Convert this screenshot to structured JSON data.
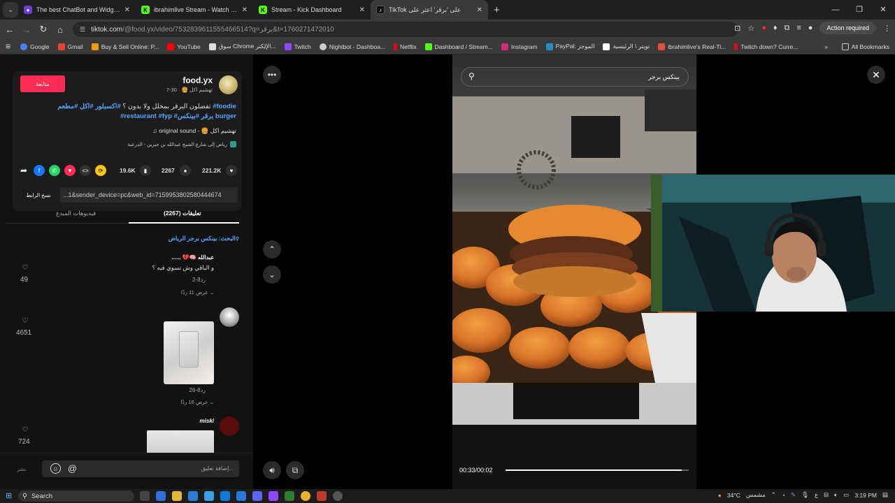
{
  "browser": {
    "tabs": [
      {
        "title": "The best ChatBot and Widgets",
        "icon": "chatbot-favicon-icon",
        "color": "#6b3fd4",
        "active": false
      },
      {
        "title": "ibrahimlive Stream - Watch Live",
        "icon": "kick-favicon-icon",
        "color": "#53fc18",
        "active": false
      },
      {
        "title": "Stream - Kick Dashboard",
        "icon": "kick-favicon-icon",
        "color": "#53fc18",
        "active": false
      },
      {
        "title": "TikTok على 'برقر' اعثر على",
        "icon": "tiktok-favicon-icon",
        "color": "#000000",
        "active": true
      }
    ],
    "url_host": "tiktok.com",
    "url_path": "/@food.yx/video/7532839611555466514?q=برقر&t=1760271472010",
    "action_required": "Action required",
    "bookmarks": [
      {
        "label": "Google",
        "color": "#4285f4"
      },
      {
        "label": "Gmail",
        "color": "#ea4335"
      },
      {
        "label": "Buy & Sell Online: P...",
        "color": "#f39c12"
      },
      {
        "label": "YouTube",
        "color": "#ff0000"
      },
      {
        "label": "سوق Chrome الإلكتر...",
        "color": "#dddddd"
      },
      {
        "label": "Twitch",
        "color": "#9146ff"
      },
      {
        "label": "Nightbot - Dashboa...",
        "color": "#cccccc"
      },
      {
        "label": "Netflix",
        "color": "#e50914"
      },
      {
        "label": "Dashboard / Stream...",
        "color": "#53fc18"
      },
      {
        "label": "Instagram",
        "color": "#d62976"
      },
      {
        "label": "PayPal: الموجز",
        "color": "#2790c3"
      },
      {
        "label": "تويتر \\ الرئيسية",
        "color": "#ffffff"
      },
      {
        "label": "ibrahimlive's Real-Ti...",
        "color": "#e74c3c"
      },
      {
        "label": "Twitch down? Curre...",
        "color": "#e50914"
      }
    ],
    "all_bookmarks": "All Bookmarks"
  },
  "post": {
    "follow_label": "متابعة",
    "username": "food.yx",
    "meta": "7-30 · 🍔 تهشيم اكل",
    "caption_text": "تفضلون البرقر بمخلل ولا بدون ؟",
    "caption_tags": "#اكسبلور #اكل #مطعم #foodie #restaurant #fyp #برقر #بينكس burger",
    "sound": "♫ original sound - 🍔 تهشيم اكل",
    "location": "رياض إلى شارع الشيخ عبدالله بن جبرين - الدرعية",
    "likes": "221.2K",
    "comments": "2267",
    "saves": "19.6K",
    "copy_link": "نسخ الرابط",
    "link_value": "...1&sender_device=pc&web_id=7159953802580444674",
    "tab_comments": "(2267) تعليقات",
    "tab_creator_videos": "فيديوهات المبدع",
    "search_suggest": "البحث: بينكس برجر الرياض",
    "add_comment_placeholder": "إضافة تعليق...",
    "send_label": "نشر"
  },
  "comments": [
    {
      "name": "...... 💔🧠 عبدالله",
      "text": "و الباقي وش تسوي فيه ؟",
      "date": "8-2",
      "reply": "رد",
      "more": "عرض 11 ردًا",
      "likes": "49"
    },
    {
      "name": "",
      "text": "",
      "date": "8-26",
      "reply": "رد",
      "more": "عرض 16 ردًا",
      "likes": "4651"
    },
    {
      "name": "miski",
      "text": "",
      "date": "",
      "reply": "",
      "more": "",
      "likes": "724"
    }
  ],
  "video": {
    "search_query": "بينكس برجر",
    "time": "00:33/00:02",
    "progress": 0.96
  },
  "taskbar": {
    "search": "Search",
    "weather": "34°C",
    "weather_label": "مشمس",
    "lang": "ع",
    "clock": "3:19 PM"
  }
}
